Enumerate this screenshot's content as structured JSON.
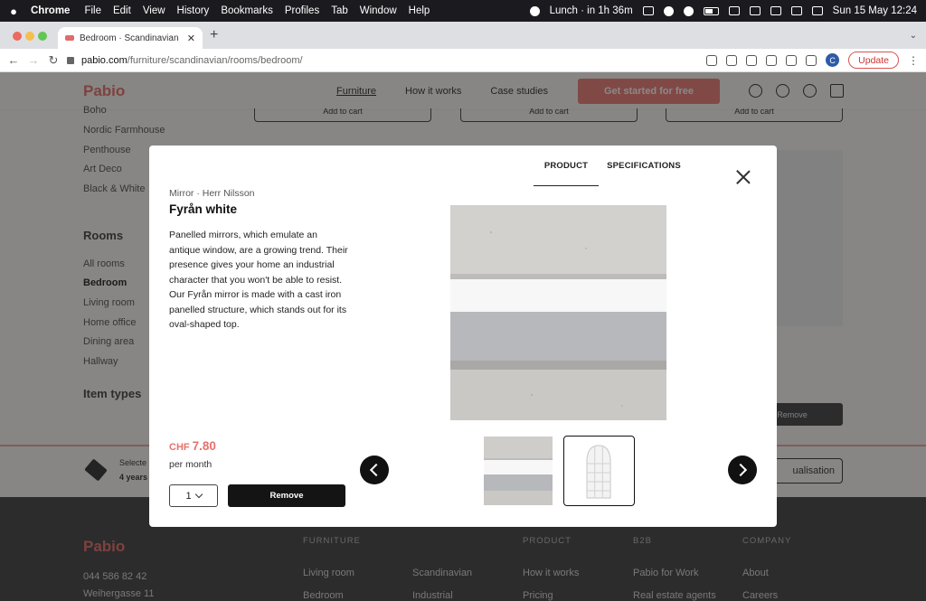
{
  "menubar": {
    "app": "Chrome",
    "items": [
      "File",
      "Edit",
      "View",
      "History",
      "Bookmarks",
      "Profiles",
      "Tab",
      "Window",
      "Help"
    ],
    "status_lunch": "Lunch",
    "status_time": "in 1h 36m",
    "datetime": "Sun 15 May  12:24"
  },
  "browser": {
    "tab_title": "Bedroom · Scandinavian · Furn",
    "url_host": "pabio.com",
    "url_path": "/furniture/scandinavian/rooms/bedroom/",
    "update_label": "Update",
    "profile_initial": "C"
  },
  "site": {
    "logo": "Pabio",
    "nav": [
      "Furniture",
      "How it works",
      "Case studies"
    ],
    "cta": "Get started for free",
    "add_to_cart": "Add to cart",
    "sidebar": {
      "styles": [
        "Boho",
        "Nordic Farmhouse",
        "Penthouse",
        "Art Deco",
        "Black & White"
      ],
      "rooms_heading": "Rooms",
      "rooms": [
        "All rooms",
        "Bedroom",
        "Living room",
        "Home office",
        "Dining area",
        "Hallway"
      ],
      "item_types_heading": "Item types"
    },
    "remove_bg": "Remove",
    "selected_label": "Selecte",
    "selected_years": "4 years",
    "visualisation": "ualisation",
    "footer": {
      "logo": "Pabio",
      "phone": "044 586 82 42",
      "address": "Weihergasse 11",
      "col_furniture": "FURNITURE",
      "col_product": "PRODUCT",
      "col_b2b": "B2B",
      "col_company": "COMPANY",
      "links_a": [
        "Living room",
        "Bedroom"
      ],
      "links_b": [
        "Scandinavian",
        "Industrial"
      ],
      "links_c": [
        "How it works",
        "Pricing"
      ],
      "links_d": [
        "Pabio for Work",
        "Real estate agents"
      ],
      "links_e": [
        "About",
        "Careers"
      ]
    }
  },
  "modal": {
    "tabs": [
      "PRODUCT",
      "SPECIFICATIONS"
    ],
    "subtitle": "Mirror · Herr Nilsson",
    "title": "Fyrån white",
    "description": "Panelled mirrors, which emulate an antique window, are a growing trend. Their presence gives your home an industrial character that you won't be able to resist. Our Fyrån mirror is made with a cast iron panelled structure, which stands out for its oval-shaped top.",
    "currency": "CHF",
    "price": "7.80",
    "per": "per month",
    "quantity": "1",
    "remove": "Remove"
  },
  "colors": {
    "brand": "#e8716b",
    "cta": "#ef7e77",
    "dark": "#141414"
  }
}
